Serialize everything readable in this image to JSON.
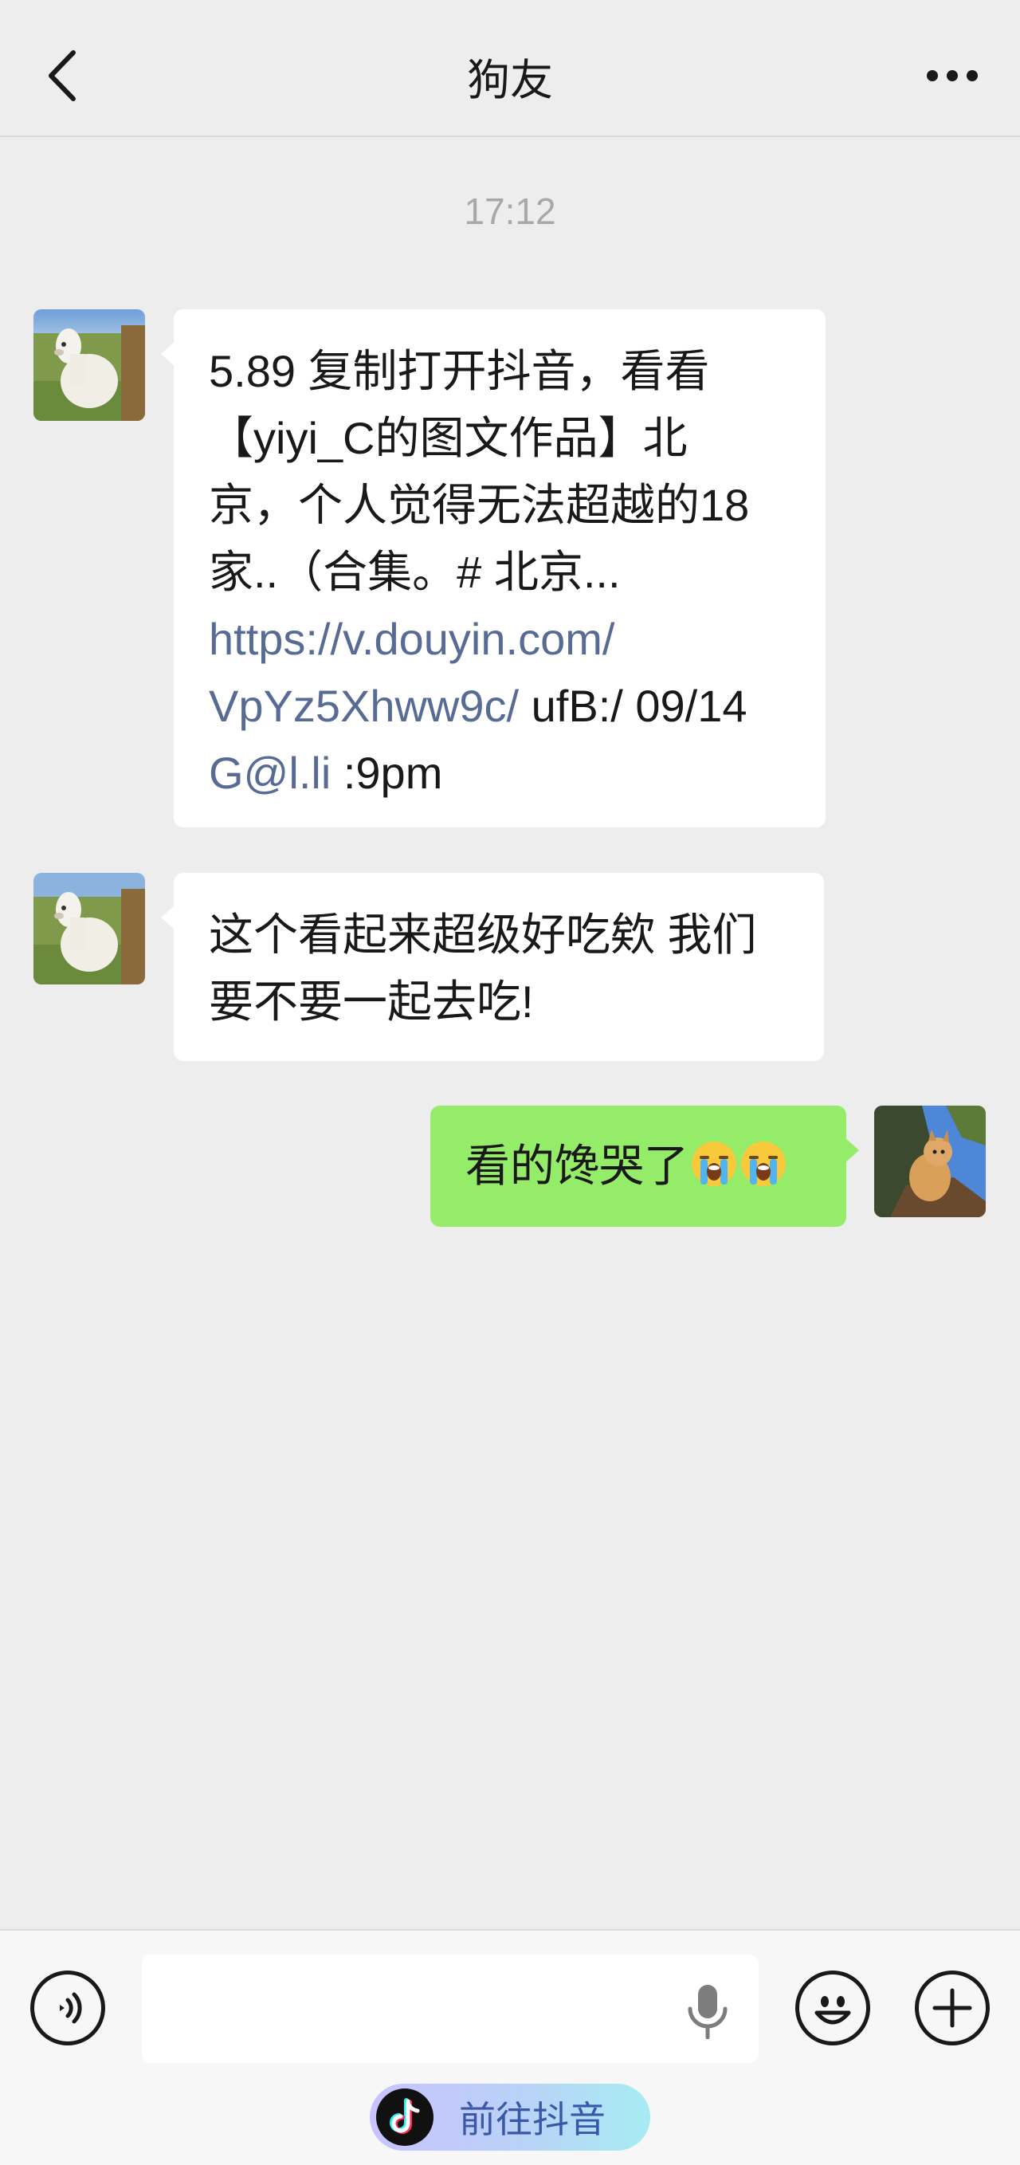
{
  "header": {
    "title": "狗友"
  },
  "timestamp": "17:12",
  "messages": [
    {
      "sender": "friend",
      "lines": [
        {
          "segments": [
            {
              "text": "5.89 复制打开抖音，看看",
              "link": false
            }
          ]
        },
        {
          "segments": [
            {
              "text": "【yiyi_C的图文作品】北",
              "link": false
            }
          ]
        },
        {
          "segments": [
            {
              "text": "京，个人觉得无法超越的18",
              "link": false
            }
          ]
        },
        {
          "segments": [
            {
              "text": "家..（合集。# 北京...",
              "link": false
            }
          ]
        },
        {
          "segments": [
            {
              "text": "https://v.douyin.com/",
              "link": true
            }
          ]
        },
        {
          "segments": [
            {
              "text": "VpYz5Xhww9c/",
              "link": true
            },
            {
              "text": " ufB:/ 09/14",
              "link": false
            }
          ]
        },
        {
          "segments": [
            {
              "text": "G@l.li",
              "link": true
            },
            {
              "text": " :9pm",
              "link": false
            }
          ]
        }
      ]
    },
    {
      "sender": "friend",
      "lines": [
        {
          "segments": [
            {
              "text": "这个看起来超级好吃欸 我们",
              "link": false
            }
          ]
        },
        {
          "segments": [
            {
              "text": "要不要一起去吃!",
              "link": false
            }
          ]
        }
      ]
    },
    {
      "sender": "me",
      "text": "看的馋哭了",
      "emojis": [
        "loudly-crying-face",
        "loudly-crying-face"
      ]
    }
  ],
  "input_bar": {
    "placeholder": "",
    "value": "",
    "douyin_label": "前往抖音"
  },
  "colors": {
    "background": "#ededed",
    "incoming_bubble": "#ffffff",
    "outgoing_bubble": "#95ec69",
    "link": "#576b95"
  },
  "icons": {
    "back": "chevron-left-icon",
    "more": "more-dots-icon",
    "voice": "voice-mode-icon",
    "mic": "microphone-icon",
    "emoji": "smiley-icon",
    "plus": "plus-icon",
    "douyin": "douyin-logo-icon"
  }
}
